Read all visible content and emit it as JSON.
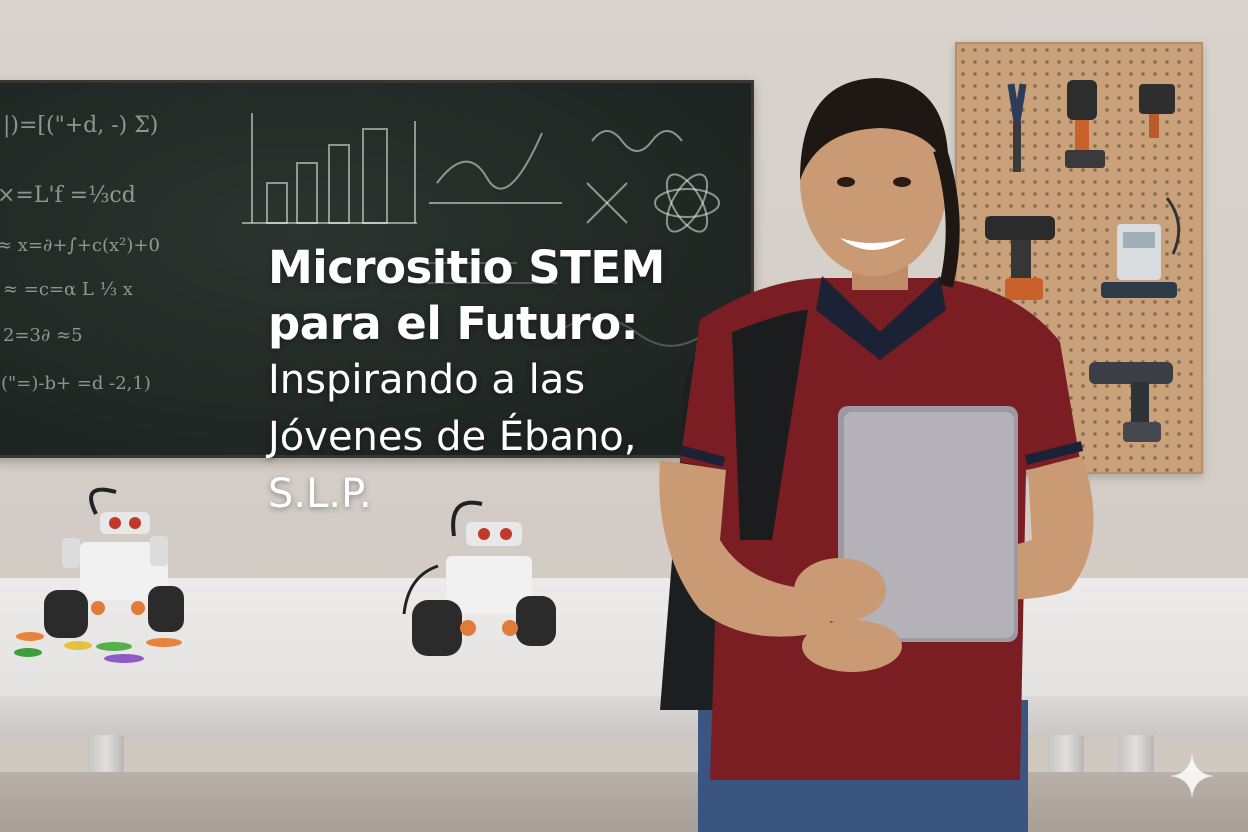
{
  "headline": {
    "bold_line_1": "Micrositio STEM",
    "bold_line_2": "para el Futuro:",
    "light_line_1": "Inspirando a las",
    "light_line_2": "Jóvenes de Ébano,",
    "light_line_3": "S.L.P."
  },
  "chalkboard": {
    "formulas": [
      "|)=[(\"+d, -) Σ)",
      "×=L'f =⅓cd",
      "≈ x=∂+∫+c(x²)+0",
      "≈ =c=α L ⅓ x",
      "2=3∂ ≈5",
      "(\"=)-b+ =d -2,1)"
    ]
  },
  "icons": [
    "sparkle-icon"
  ],
  "colors": {
    "shirt": "#7a1e24",
    "collar": "#1c2235",
    "board": "#1f2623",
    "pegboard": "#c9a27c"
  }
}
